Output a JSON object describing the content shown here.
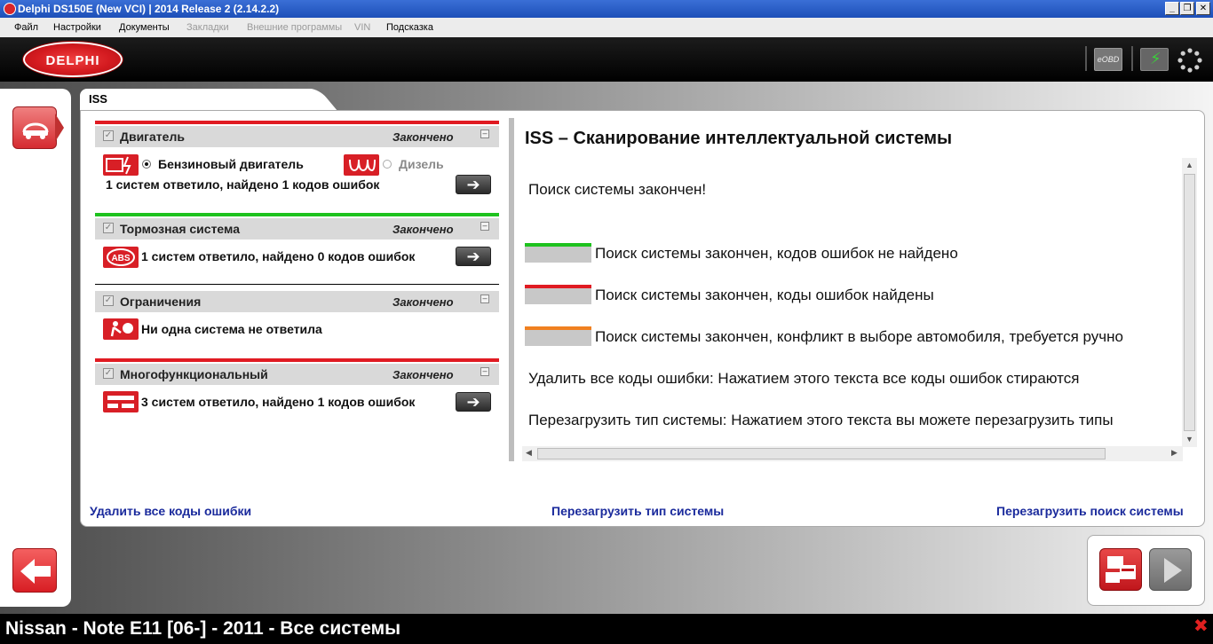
{
  "window": {
    "title": "Delphi DS150E (New VCI) | 2014 Release 2 (2.14.2.2)",
    "minimize": "_",
    "restore": "❐",
    "close": "✕"
  },
  "menu": [
    {
      "label": "Файл",
      "enabled": true
    },
    {
      "label": "Настройки",
      "enabled": true
    },
    {
      "label": "Документы",
      "enabled": true
    },
    {
      "label": "Закладки",
      "enabled": false
    },
    {
      "label": "Внешние программы",
      "enabled": false
    },
    {
      "label": "VIN",
      "enabled": false
    },
    {
      "label": "Подсказка",
      "enabled": true
    }
  ],
  "header": {
    "logo": "DELPHI",
    "eobd": "eOBD"
  },
  "tab": {
    "label": "ISS"
  },
  "groups": [
    {
      "name": "Двигатель",
      "status": "Закончено",
      "status_color": "#e01b22",
      "options": {
        "petrol": "Бензиновый двигатель",
        "diesel": "Дизель"
      },
      "result": "1 систем ответило, найдено 1 кодов ошибок"
    },
    {
      "name": "Тормозная система",
      "status": "Закончено",
      "status_color": "#1ec21e",
      "icon_text": "ABS",
      "result": "1 систем ответило, найдено 0 кодов ошибок"
    },
    {
      "name": "Ограничения",
      "status": "Закончено",
      "status_color": "#000000",
      "result": "Ни одна система не ответила"
    },
    {
      "name": "Многофункциональный",
      "status": "Закончено",
      "status_color": "#e01b22",
      "result": "3 систем ответило, найдено 1 кодов ошибок"
    }
  ],
  "info": {
    "title": "ISS – Сканирование интеллектуальной системы",
    "search_done": "Поиск системы закончен!",
    "legend": [
      {
        "color": "#1ec21e",
        "text": "Поиск системы закончен, кодов ошибок не найдено"
      },
      {
        "color": "#e01b22",
        "text": "Поиск системы закончен, коды ошибок найдены"
      },
      {
        "color": "#f08020",
        "text": "Поиск системы закончен, конфликт в выборе автомобиля, требуется ручно"
      }
    ],
    "delete_help": "Удалить все коды ошибки: Нажатием этого текста все коды ошибок стираются",
    "reload_help": "Перезагрузить тип системы: Нажатием этого текста вы можете перезагрузить типы"
  },
  "links": {
    "delete_all": "Удалить все коды ошибки",
    "reload_type": "Перезагрузить тип системы",
    "reload_search": "Перезагрузить поиск системы"
  },
  "status": {
    "vehicle": "Nissan - Note E11 [06-] - 2011 - Все системы"
  }
}
